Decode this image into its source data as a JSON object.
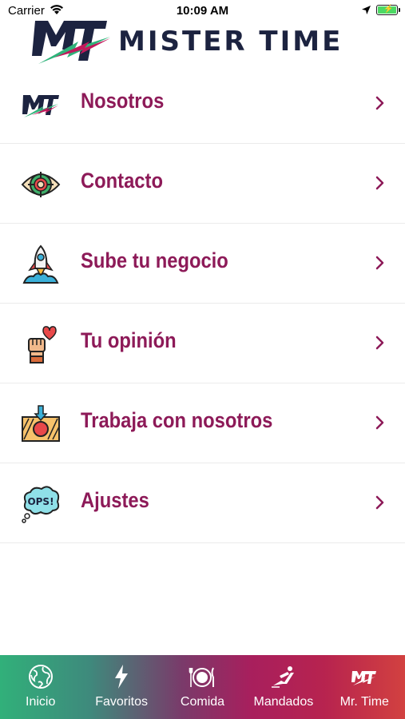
{
  "status_bar": {
    "carrier": "Carrier",
    "time": "10:09 AM"
  },
  "header": {
    "logo_text": "MISTER TIME",
    "logo_mark": "MT"
  },
  "menu": [
    {
      "label": "Nosotros",
      "icon": "mister-time-logo-icon"
    },
    {
      "label": "Contacto",
      "icon": "eye-target-icon"
    },
    {
      "label": "Sube tu negocio",
      "icon": "rocket-icon"
    },
    {
      "label": "Tu opinión",
      "icon": "fist-heart-icon"
    },
    {
      "label": "Trabaja con nosotros",
      "icon": "package-icon"
    },
    {
      "label": "Ajustes",
      "icon": "ops-bubble-icon"
    }
  ],
  "tabs": [
    {
      "label": "Inicio",
      "icon": "globe-icon"
    },
    {
      "label": "Favoritos",
      "icon": "lightning-icon"
    },
    {
      "label": "Comida",
      "icon": "plate-cutlery-icon"
    },
    {
      "label": "Mandados",
      "icon": "runner-icon"
    },
    {
      "label": "Mr. Time",
      "icon": "mt-logo-icon"
    }
  ],
  "colors": {
    "menu_text": "#8d1a58",
    "logo_text": "#1c2340",
    "tab_gradient_start": "#31b07a",
    "tab_gradient_end": "#d24140"
  }
}
